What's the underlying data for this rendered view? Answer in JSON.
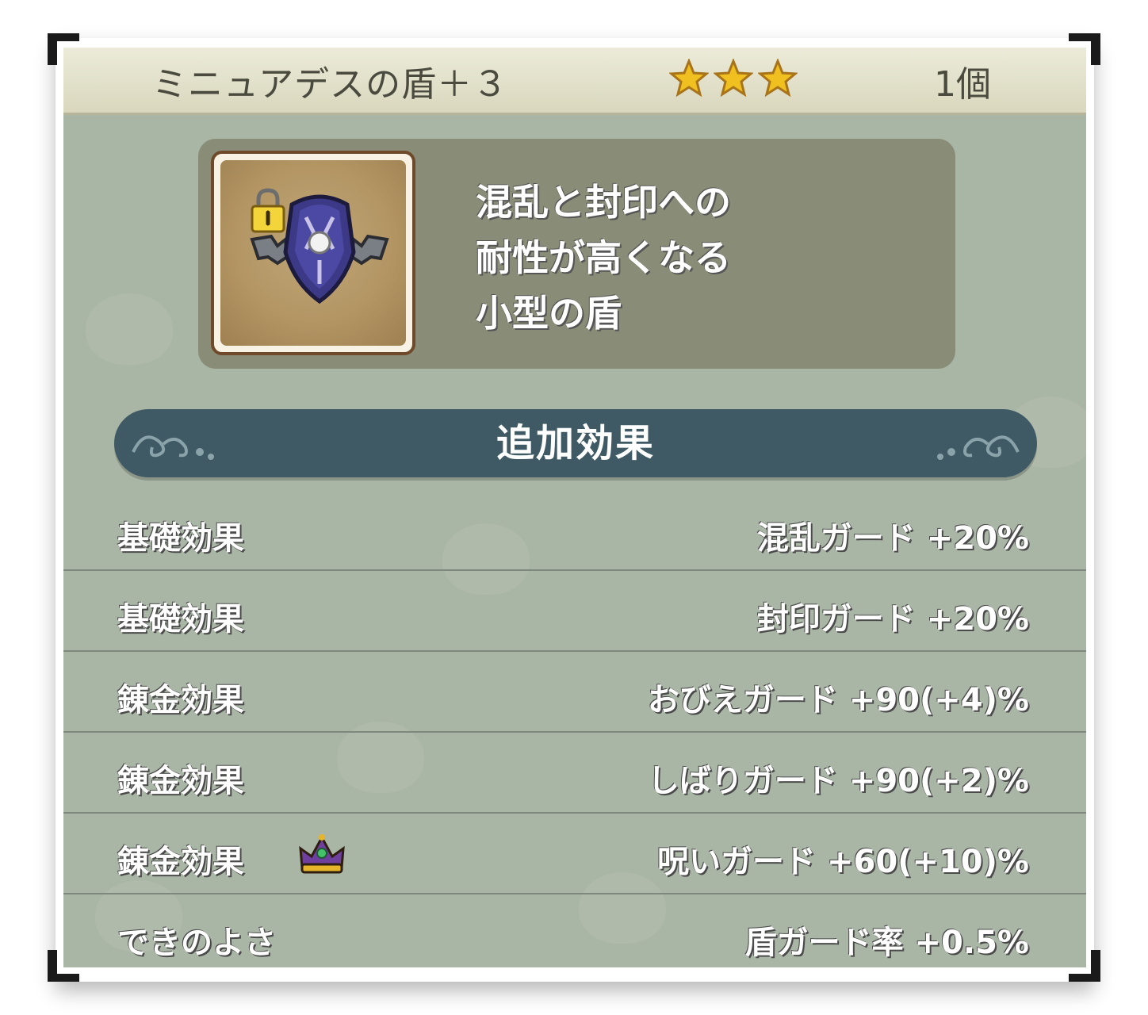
{
  "header": {
    "item_name": "ミニュアデスの盾＋３",
    "rarity_stars": 3,
    "star_color": "#f0c020",
    "count": "1個"
  },
  "item": {
    "icon": "shield-icon",
    "locked": true,
    "lock_icon": "lock-icon",
    "description_lines": [
      "混乱と封印への",
      "耐性が高くなる",
      "小型の盾"
    ]
  },
  "section": {
    "title": "追加効果",
    "bar_color": "#3f5a64"
  },
  "effects": [
    {
      "label": "基礎効果",
      "value": "混乱ガード +20%"
    },
    {
      "label": "基礎効果",
      "value": "封印ガード +20%"
    },
    {
      "label": "錬金効果",
      "value": "おびえガード +90(+4)%"
    },
    {
      "label": "錬金効果",
      "value": "しばりガード +90(+2)%"
    },
    {
      "label": "錬金効果",
      "value": "呪いガード +60(+10)%",
      "badge_icon": "crown-icon"
    },
    {
      "label": "できのよさ",
      "value": "盾ガード率 +0.5%"
    }
  ]
}
